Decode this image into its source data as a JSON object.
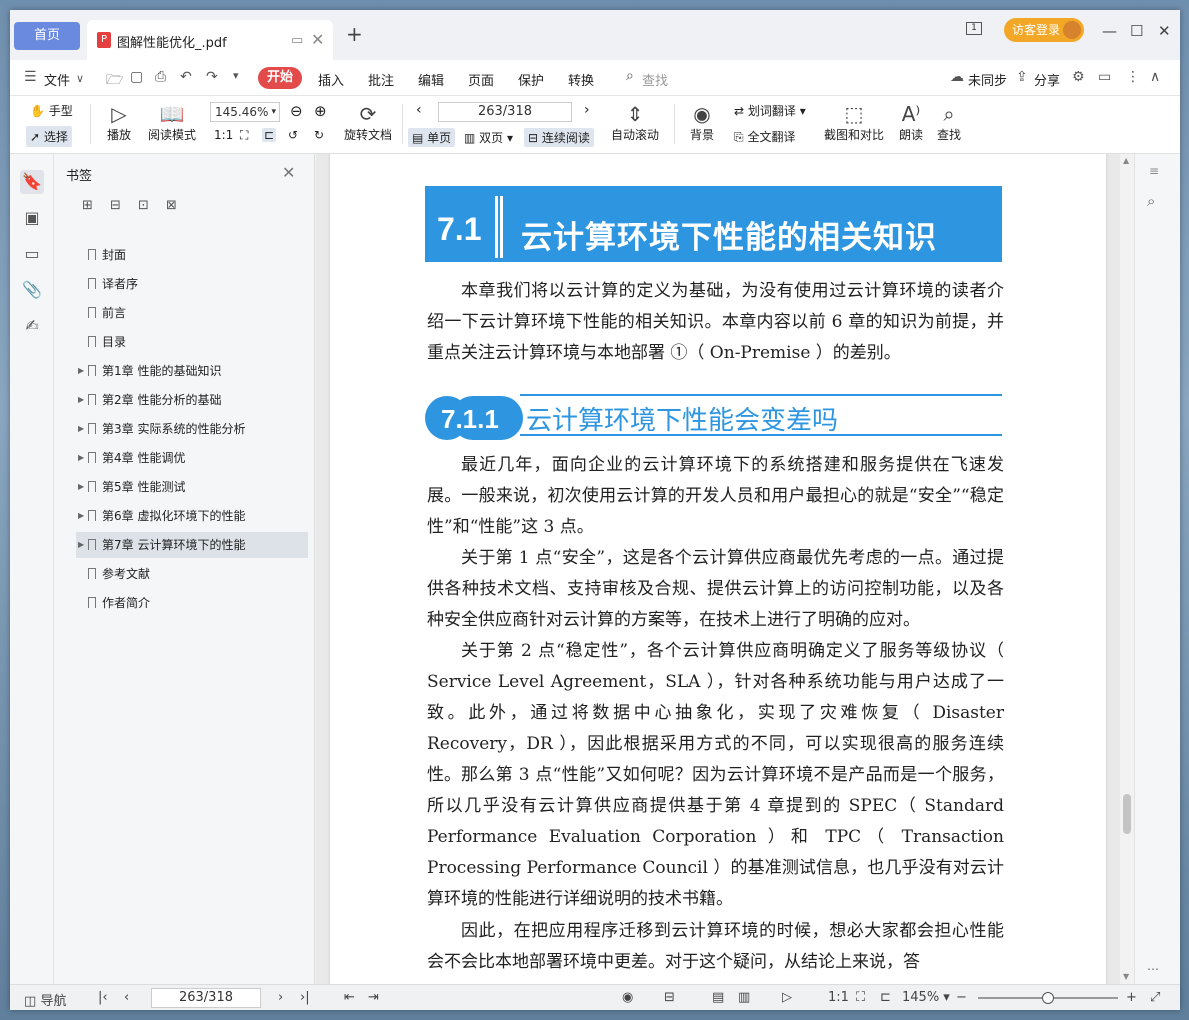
{
  "tabs": {
    "home": "首页",
    "doc_title": "图解性能优化_.pdf",
    "new_tab": "+",
    "visitor": "访客登录"
  },
  "menu": {
    "file": "文件",
    "start": "开始",
    "items": [
      "插入",
      "批注",
      "编辑",
      "页面",
      "保护",
      "转换"
    ],
    "search_placeholder": "查找",
    "unsynced": "未同步",
    "share": "分享"
  },
  "toolbar": {
    "hand": "手型",
    "select": "选择",
    "play": "播放",
    "read_mode": "阅读模式",
    "zoom": "145.46%",
    "rotate": "旋转文档",
    "page": "263/318",
    "single": "单页",
    "double": "双页",
    "continuous": "连续阅读",
    "autoscroll": "自动滚动",
    "background": "背景",
    "word_translate": "划词翻译",
    "full_translate": "全文翻译",
    "screenshot": "截图和对比",
    "read_aloud": "朗读",
    "find": "查找"
  },
  "panel": {
    "title": "书签",
    "bookmarks": [
      {
        "label": "封面",
        "expandable": false
      },
      {
        "label": "译者序",
        "expandable": false
      },
      {
        "label": "前言",
        "expandable": false
      },
      {
        "label": "目录",
        "expandable": false
      },
      {
        "label": "第1章 性能的基础知识",
        "expandable": true
      },
      {
        "label": "第2章 性能分析的基础",
        "expandable": true
      },
      {
        "label": "第3章 实际系统的性能分析",
        "expandable": true
      },
      {
        "label": "第4章 性能调优",
        "expandable": true
      },
      {
        "label": "第5章 性能测试",
        "expandable": true
      },
      {
        "label": "第6章 虚拟化环境下的性能",
        "expandable": true
      },
      {
        "label": "第7章 云计算环境下的性能",
        "expandable": true,
        "selected": true
      },
      {
        "label": "参考文献",
        "expandable": false
      },
      {
        "label": "作者简介",
        "expandable": false
      }
    ]
  },
  "document": {
    "h1_num": "7.1",
    "h1_text": "云计算环境下性能的相关知识",
    "intro": "本章我们将以云计算的定义为基础，为没有使用过云计算环境的读者介绍一下云计算环境下性能的相关知识。本章内容以前 6 章的知识为前提，并重点关注云计算环境与本地部署 ①（ On-Premise ）的差别。",
    "h2_num": "7.1.1",
    "h2_text": "云计算环境下性能会变差吗",
    "p1": "最近几年，面向企业的云计算环境下的系统搭建和服务提供在飞速发展。一般来说，初次使用云计算的开发人员和用户最担心的就是“安全”“稳定性”和“性能”这 3 点。",
    "p2": "关于第 1 点“安全”，这是各个云计算供应商最优先考虑的一点。通过提供各种技术文档、支持审核及合规、提供云计算上的访问控制功能，以及各种安全供应商针对云计算的方案等，在技术上进行了明确的应对。",
    "p3": "关于第 2 点“稳定性”，各个云计算供应商明确定义了服务等级协议（ Service Level Agreement，SLA ），针对各种系统功能与用户达成了一致。此外，通过将数据中心抽象化，实现了灾难恢复（ Disaster Recovery，DR ），因此根据采用方式的不同，可以实现很高的服务连续性。",
    "p4": "那么第 3 点“性能”又如何呢？因为云计算环境不是产品而是一个服务，所以几乎没有云计算供应商提供基于第 4 章提到的 SPEC（ Standard Performance Evaluation Corporation ）和 TPC（ Transaction Processing Performance Council ）的基准测试信息，也几乎没有对云计算环境的性能进行详细说明的技术书籍。",
    "p5": "因此，在把应用程序迁移到云计算环境的时候，想必大家都会担心性能会不会比本地部署环境中更差。对于这个疑问，从结论上来说，答"
  },
  "statusbar": {
    "nav": "导航",
    "page": "263/318",
    "zoom": "145%"
  },
  "colors": {
    "accent_blue": "#2e96e0",
    "start_red": "#e34b4b",
    "visitor_orange": "#f3a727",
    "home_blue": "#6a8ae0"
  }
}
